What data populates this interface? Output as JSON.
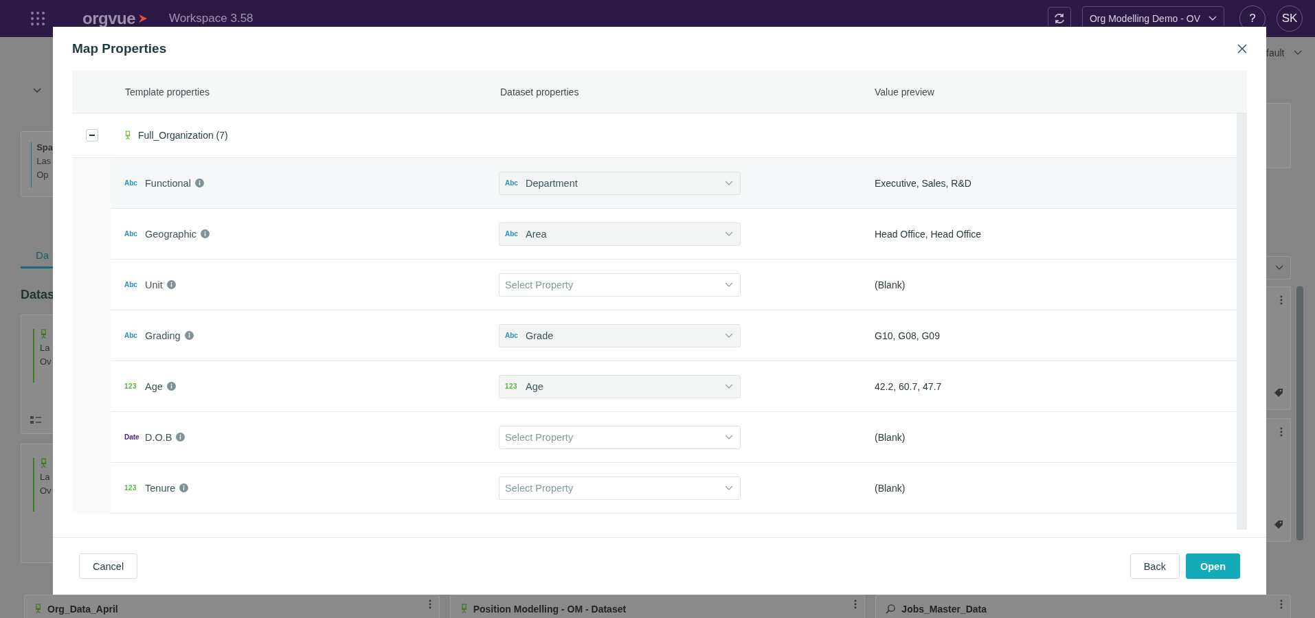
{
  "top_bar": {
    "app_name": "orgvue",
    "workspace": "Workspace 3.58",
    "workspace_selector": "Org Modelling Demo - OV",
    "help": "?",
    "avatar": "SK"
  },
  "background": {
    "view_selector": "fault",
    "top_card_lines": [
      "Spa",
      "Las",
      "Op"
    ],
    "tab": "Da",
    "section_heading": "Datas",
    "left_cards": [
      {
        "lines": [
          "La",
          "Ov"
        ]
      },
      {
        "lines": [
          "La",
          "Ov"
        ]
      }
    ],
    "bottom_cards": [
      {
        "kind": "chair",
        "title": "Org_Data_April"
      },
      {
        "kind": "chair",
        "title": "Position Modelling - OM - Dataset"
      },
      {
        "kind": "search",
        "title": "Jobs_Master_Data"
      }
    ]
  },
  "modal": {
    "title": "Map Properties",
    "columns": [
      "Template properties",
      "Dataset properties",
      "Value preview"
    ],
    "group": {
      "label": "Full_Organization (7)",
      "expanded": true
    },
    "rows": [
      {
        "kind": "text",
        "badge": "Abc",
        "label": "Functional",
        "mapping": {
          "kind": "text",
          "badge": "Abc",
          "value": "Department"
        },
        "preview": "Executive, Sales, R&D",
        "selected": true
      },
      {
        "kind": "text",
        "badge": "Abc",
        "label": "Geographic",
        "mapping": {
          "kind": "text",
          "badge": "Abc",
          "value": "Area"
        },
        "preview": "Head Office, Head Office",
        "selected": false
      },
      {
        "kind": "text",
        "badge": "Abc",
        "label": "Unit",
        "mapping": {
          "placeholder": "Select Property"
        },
        "preview": "(Blank)",
        "selected": false
      },
      {
        "kind": "text",
        "badge": "Abc",
        "label": "Grading",
        "mapping": {
          "kind": "text",
          "badge": "Abc",
          "value": "Grade"
        },
        "preview": "G10, G08, G09",
        "selected": false
      },
      {
        "kind": "number",
        "badge": "123",
        "label": "Age",
        "mapping": {
          "kind": "number",
          "badge": "123",
          "value": "Age"
        },
        "preview": "42.2, 60.7, 47.7",
        "selected": false
      },
      {
        "kind": "date",
        "badge": "Date",
        "label": "D.O.B",
        "mapping": {
          "placeholder": "Select Property"
        },
        "preview": "(Blank)",
        "selected": false
      },
      {
        "kind": "number",
        "badge": "123",
        "label": "Tenure",
        "mapping": {
          "placeholder": "Select Property"
        },
        "preview": "(Blank)",
        "selected": false
      }
    ],
    "buttons": {
      "cancel": "Cancel",
      "back": "Back",
      "open": "Open"
    }
  }
}
